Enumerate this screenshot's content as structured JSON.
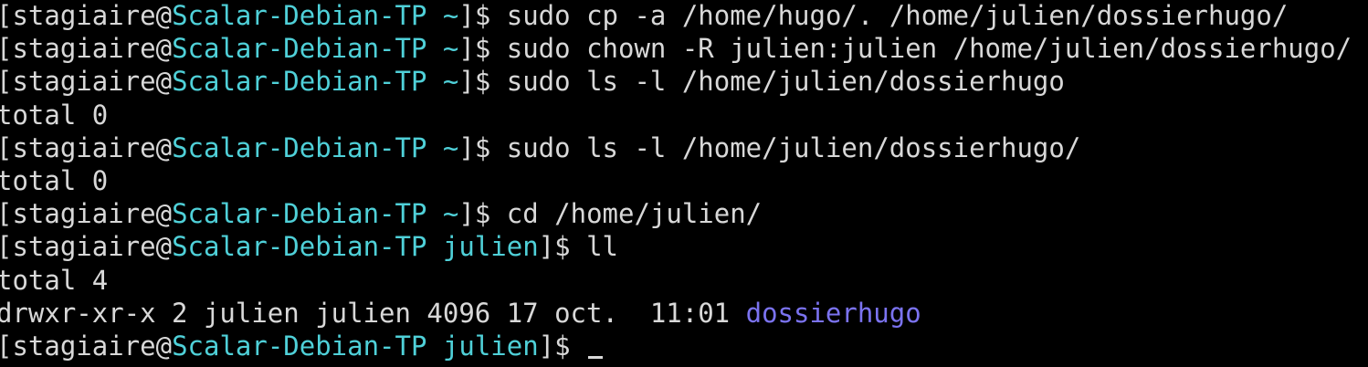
{
  "terminal": {
    "prompt": {
      "open_bracket": "[",
      "user": "stagiaire",
      "at": "@",
      "host": "Scalar-Debian-TP",
      "space": " ",
      "close": "]$ "
    },
    "lines": [
      {
        "type": "prompt",
        "cwd": "~",
        "command": "sudo cp -a /home/hugo/. /home/julien/dossierhugo/"
      },
      {
        "type": "prompt",
        "cwd": "~",
        "command": "sudo chown -R julien:julien /home/julien/dossierhugo/"
      },
      {
        "type": "prompt",
        "cwd": "~",
        "command": "sudo ls -l /home/julien/dossierhugo"
      },
      {
        "type": "output",
        "text": "total 0"
      },
      {
        "type": "prompt",
        "cwd": "~",
        "command": "sudo ls -l /home/julien/dossierhugo/"
      },
      {
        "type": "output",
        "text": "total 0"
      },
      {
        "type": "prompt",
        "cwd": "~",
        "command": "cd /home/julien/"
      },
      {
        "type": "prompt",
        "cwd": "julien",
        "command": "ll"
      },
      {
        "type": "output",
        "text": "total 4"
      },
      {
        "type": "listing",
        "text": "drwxr-xr-x 2 julien julien 4096 17 oct.  11:01 ",
        "name": "dossierhugo"
      },
      {
        "type": "prompt",
        "cwd": "julien",
        "command": ""
      }
    ]
  },
  "colors": {
    "background": "#000000",
    "foreground": "#d8d8d8",
    "host": "#4fd0d8",
    "directory": "#7b73f0"
  }
}
